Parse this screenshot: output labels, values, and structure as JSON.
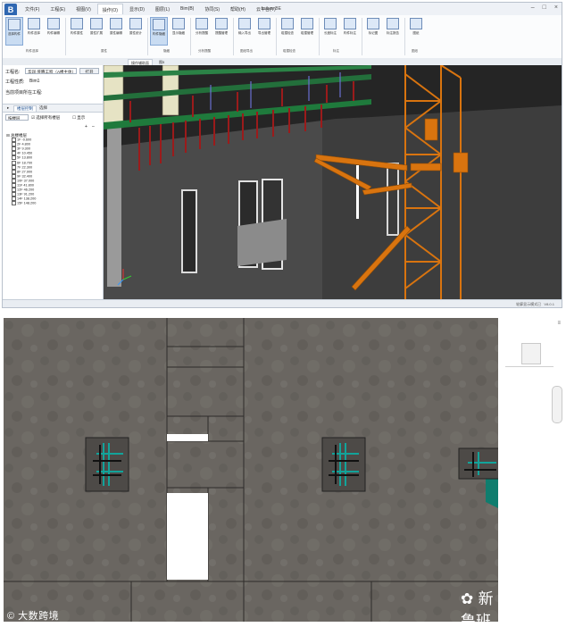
{
  "app": {
    "title": "Luban BE",
    "menus": [
      "文件(F)",
      "工程(E)",
      "视图(V)",
      "操作(O)",
      "显示(D)",
      "图层(L)",
      "Bim(B)",
      "协同(S)",
      "帮助(H)",
      "云平台(Y)"
    ],
    "active_menu": "操作(O)",
    "window_controls": [
      "–",
      "□",
      "×"
    ]
  },
  "ribbon": {
    "groups": [
      {
        "label": "构件选择",
        "buttons": [
          "选择构件",
          "构件选择",
          "构件编辑"
        ]
      },
      {
        "label": "属性",
        "buttons": [
          "构件属性",
          "属性扩展",
          "属性编辑",
          "属性统计"
        ]
      },
      {
        "label": "隐藏",
        "buttons": [
          "构件隐藏",
          "显示隐藏"
        ]
      },
      {
        "label": "分析提醒",
        "buttons": [
          "分析提醒",
          "提醒管理"
        ]
      },
      {
        "label": "图纸导出",
        "buttons": [
          "输入导出",
          "导出管理"
        ]
      },
      {
        "label": "碰撞检查",
        "buttons": [
          "碰撞检查",
          "碰撞管理"
        ]
      },
      {
        "label": "标注",
        "buttons": [
          "长度标注",
          "构件标注"
        ]
      },
      {
        "label": "",
        "buttons": [
          "标记图",
          "标注报告"
        ]
      },
      {
        "label": "图纸",
        "buttons": [
          "图纸"
        ]
      }
    ],
    "selected_buttons": [
      "选择构件",
      "构件隐藏"
    ]
  },
  "doc_tabs": [
    "操作辅助面",
    "图5"
  ],
  "left_panel": {
    "project_label": "工程名:",
    "project_value": "华润·肝腾工程（A楼主体）",
    "open_button": "打开",
    "model_label": "工程性质:",
    "model_value": "Bim1",
    "current_label": "当前项目所在工程:",
    "tabs": [
      "楼层控制",
      "选择"
    ],
    "filter_value": "按楼层",
    "filter_options": [
      "选择所有楼层",
      "显示"
    ],
    "tree_root": "总楼楼层",
    "floors": [
      "1F -0.600",
      "2F 4.800",
      "3F 9.300",
      "4F 10.450",
      "5F 13.800",
      "6F 18.700",
      "7F 22.300",
      "8F 27.900",
      "9F 32.400",
      "10F 37.000",
      "11F 41.800",
      "12F 46.200",
      "13F 91.200",
      "14F 138.200",
      "15F 148.200"
    ]
  },
  "status": {
    "text": "轮廓显示模式已",
    "version": "V8.0.1"
  },
  "watermarks": {
    "left": "大数跨境",
    "right": "新鲁班"
  },
  "colors": {
    "crane": "#d9740f",
    "slab_green": "#1f7a3c",
    "rebar_red": "#9b1b1b",
    "column_cream": "#e6e3c4",
    "floor_gray": "#6a6661",
    "panel_teal": "#0f7d6e"
  }
}
